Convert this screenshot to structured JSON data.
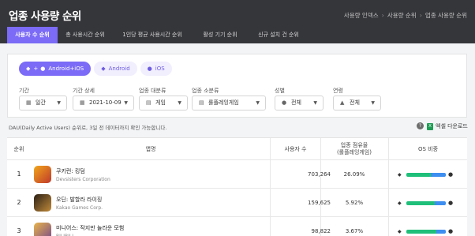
{
  "page": {
    "title": "업종 사용량 순위",
    "breadcrumb": [
      "사용량 인덱스",
      "사용량 순위",
      "업종 사용량 순위"
    ]
  },
  "tabs": [
    "사용자 수 순위",
    "총 사용시간 순위",
    "1인당 평균 사용시간 순위",
    "활성 기기 순위",
    "신규 설치 건 순위"
  ],
  "active_tab": "사용자 수 순위",
  "platform_filter": {
    "options": [
      "Android+iOS",
      "Android",
      "iOS"
    ],
    "selected": "Android+iOS",
    "combined_prefix": "+"
  },
  "filters": {
    "period": {
      "label": "기간",
      "value": "일간"
    },
    "period_detail": {
      "label": "기간 상세",
      "value": "2021-10-09"
    },
    "category_major": {
      "label": "업종 대분류",
      "value": "게임"
    },
    "category_minor": {
      "label": "업종 소분류",
      "value": "롤플레잉게임"
    },
    "gender": {
      "label": "성별",
      "value": "전체"
    },
    "age": {
      "label": "연령",
      "value": "전체"
    }
  },
  "note": "DAU(Daily Active Users) 순위로, 3일 전 데이터까지 확인 가능합니다.",
  "help_label": "?",
  "excel_label": "엑셀 다운로드",
  "excel_icon_label": "X",
  "table": {
    "headers": {
      "rank": "순위",
      "app": "앱명",
      "users": "사용자 수",
      "share_line1": "업종 점유율",
      "share_line2": "(롤플레잉게임)",
      "os": "OS 비중"
    },
    "rows": [
      {
        "rank": "1",
        "name": "쿠키런: 킹덤",
        "corp": "Devsisters Corporation",
        "users": "703,264",
        "share": "26.09%",
        "android_share": 0.62,
        "icon_color": "#f0a61b",
        "icon_color2": "#c0392b"
      },
      {
        "rank": "2",
        "name": "오딘: 발할라 라이징",
        "corp": "Kakao Games Corp.",
        "users": "159,625",
        "share": "5.92%",
        "android_share": 0.72,
        "icon_color": "#2b2015",
        "icon_color2": "#c08a3a"
      },
      {
        "rank": "3",
        "name": "미니어스: 작지만 놀라운 모험",
        "corp": "BILIBILI",
        "users": "98,822",
        "share": "3.67%",
        "android_share": 0.75,
        "icon_color": "#e8b44a",
        "icon_color2": "#7a4b8a"
      }
    ]
  },
  "colors": {
    "accent": "#7b6bf6",
    "header_bg": "#35363a",
    "android": "#1fbf7a",
    "ios": "#3d8ef0"
  }
}
